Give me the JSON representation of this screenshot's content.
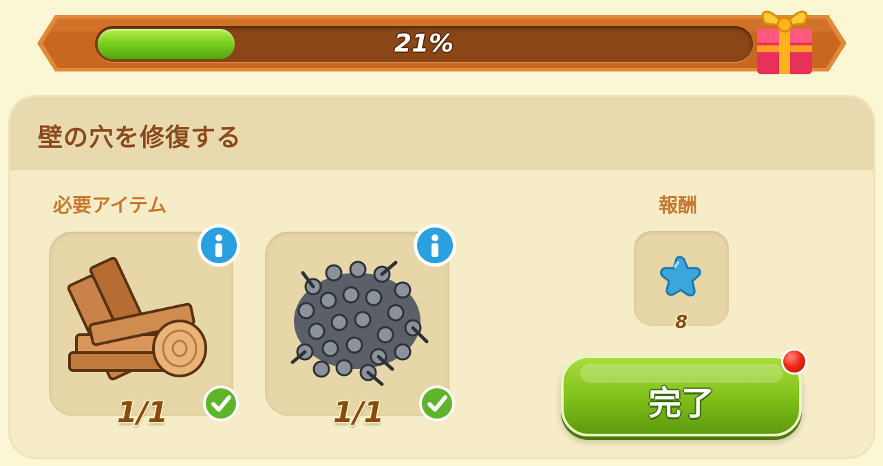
{
  "progress": {
    "percent_text": "21%",
    "value_fraction": 0.21
  },
  "task": {
    "title": "壁の穴を修復する"
  },
  "required_items": {
    "label": "必要アイテム",
    "items": [
      {
        "name": "wood-planks",
        "count": "1/1",
        "icon": "wood-planks-icon",
        "complete": true
      },
      {
        "name": "screws",
        "count": "1/1",
        "icon": "screws-pile-icon",
        "complete": true
      }
    ]
  },
  "reward": {
    "label": "報酬",
    "icon": "blue-star-icon",
    "amount": "8"
  },
  "complete_button": {
    "label": "完了"
  },
  "colors": {
    "background": "#fbf6d4",
    "banner": "#c96a24",
    "progress_green": "#7cd120",
    "title_brown": "#8a4a1c",
    "label_orange": "#c8782e",
    "button_green": "#83c21c",
    "info_blue": "#2aa0e0",
    "notification_red": "#f02a1a"
  }
}
